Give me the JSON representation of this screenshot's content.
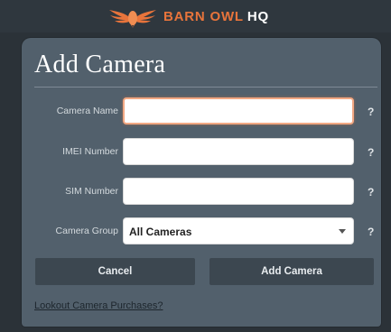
{
  "brand": {
    "name": "BARN OWL",
    "suffix": "HQ",
    "logo_icon": "owl-wings-icon",
    "accent_color": "#e8743b"
  },
  "modal": {
    "title": "Add Camera",
    "fields": [
      {
        "label": "Camera Name",
        "value": "",
        "help": "?"
      },
      {
        "label": "IMEI Number",
        "value": "",
        "help": "?"
      },
      {
        "label": "SIM Number",
        "value": "",
        "help": "?"
      }
    ],
    "group": {
      "label": "Camera Group",
      "selected": "All Cameras",
      "help": "?"
    },
    "buttons": {
      "cancel": "Cancel",
      "add": "Add Camera"
    },
    "link": "Lookout Camera Purchases?"
  }
}
